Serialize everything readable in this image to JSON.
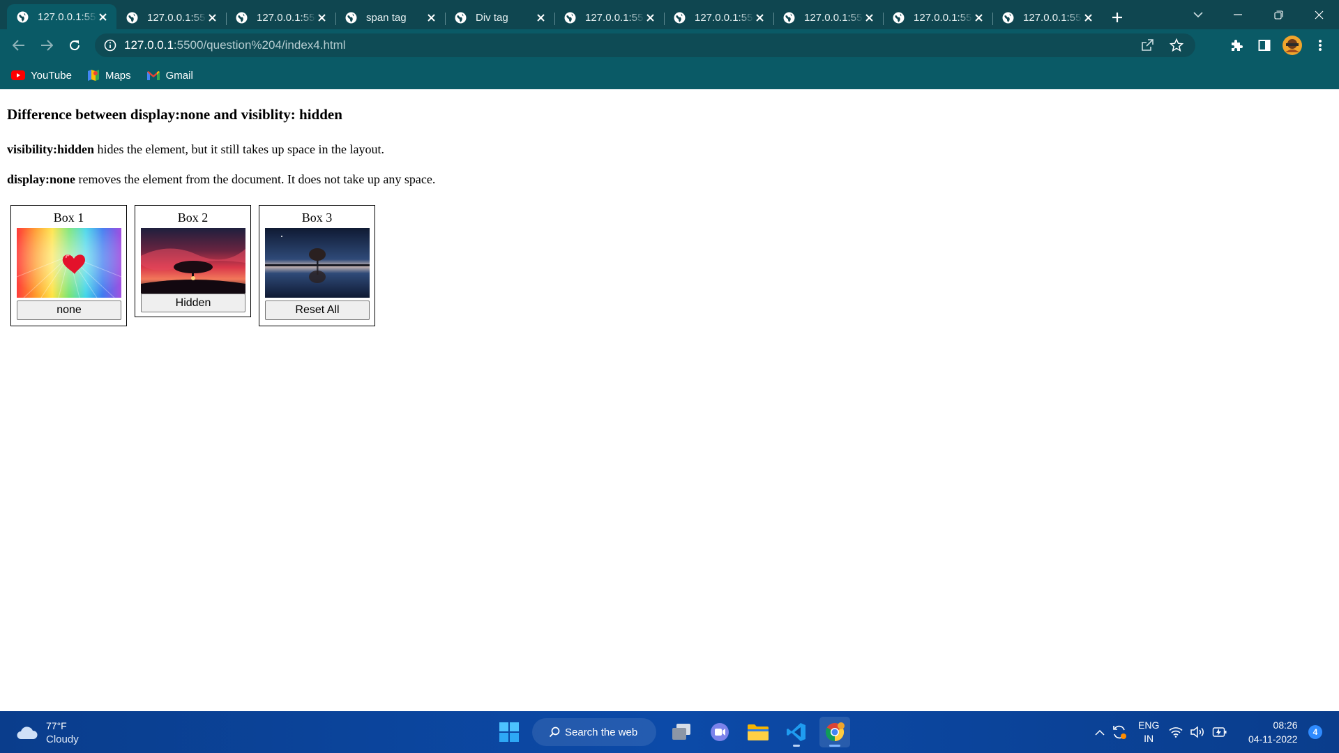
{
  "browser": {
    "tabs": [
      {
        "title": "127.0.0.1:5500/question%204/index4.html",
        "active": true
      },
      {
        "title": "127.0.0.1:5500",
        "active": false
      },
      {
        "title": "127.0.0.1:5500",
        "active": false
      },
      {
        "title": "span tag",
        "active": false
      },
      {
        "title": "Div tag",
        "active": false
      },
      {
        "title": "127.0.0.1:5500",
        "active": false
      },
      {
        "title": "127.0.0.1:5500",
        "active": false
      },
      {
        "title": "127.0.0.1:5500",
        "active": false
      },
      {
        "title": "127.0.0.1:5500",
        "active": false
      },
      {
        "title": "127.0.0.1:5500",
        "active": false
      }
    ],
    "url_host": "127.0.0.1",
    "url_path": ":5500/question%204/index4.html",
    "bookmarks": [
      {
        "label": "YouTube",
        "icon": "youtube-icon"
      },
      {
        "label": "Maps",
        "icon": "maps-icon"
      },
      {
        "label": "Gmail",
        "icon": "gmail-icon"
      }
    ],
    "colors": {
      "frame": "#0f4650",
      "toolbar": "#0a5a66"
    }
  },
  "page": {
    "heading": "Difference between display:none and visiblity: hidden",
    "p1_bold": "visibility:hidden",
    "p1_text": " hides the element, but it still takes up space in the layout.",
    "p2_bold": "display:none",
    "p2_text": " removes the element from the document. It does not take up any space.",
    "boxes": [
      {
        "title": "Box 1",
        "button": "none",
        "image": "rainbow-heart-image"
      },
      {
        "title": "Box 2",
        "button": "Hidden",
        "image": "sunset-tree-image"
      },
      {
        "title": "Box 3",
        "button": "Reset All",
        "image": "lake-tree-reflection-image"
      }
    ]
  },
  "taskbar": {
    "weather_temp": "77°F",
    "weather_cond": "Cloudy",
    "search_label": "Search the web",
    "lang_top": "ENG",
    "lang_bottom": "IN",
    "time": "08:26",
    "date": "04-11-2022",
    "notification_count": "4"
  }
}
